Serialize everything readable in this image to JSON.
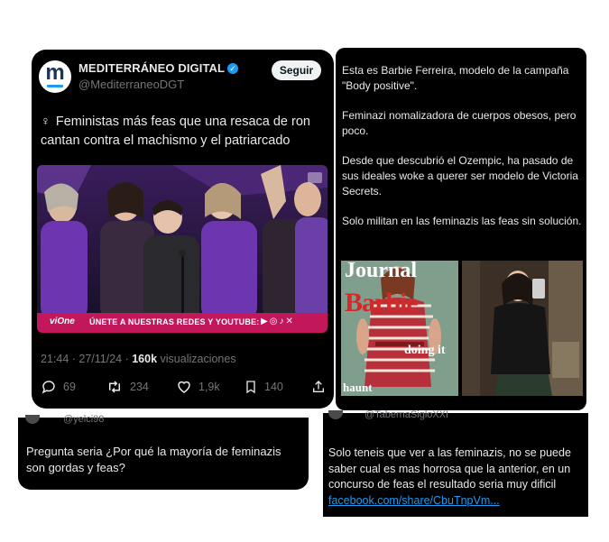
{
  "tweet": {
    "author_name": "MEDITERRÁNEO DIGITAL",
    "author_handle": "@MediterraneoDGT",
    "avatar_letter": "m",
    "follow_label": "Seguir",
    "text": "Feministas más feas que una resaca de ron cantan contra el machismo y el patriarcado",
    "media_banner_logo": "viOne",
    "media_banner_text": "ÚNETE A NUESTRAS REDES Y YOUTUBE:",
    "timestamp": "21:44 · 27/11/24 · ",
    "views_count": "160k",
    "views_label": " visualizaciones",
    "replies": "69",
    "reposts": "234",
    "likes": "1,9k",
    "bookmarks": "140"
  },
  "side_post": {
    "paragraphs": [
      "Esta es Barbie Ferreira, modelo de la campaña \"Body positive\".",
      "Feminazi nomalizadora de cuerpos obesos, pero poco.",
      "Desde que descubrió el Ozempic, ha pasado de sus ideales woke a querer ser modelo de Victoria Secrets.",
      "Solo militan en las feminazis las feas sin solución."
    ],
    "cover_top": "Journal",
    "cover_title": "Barbie",
    "cover_doit": "doing it",
    "cover_haunt": "haunt"
  },
  "reply1": {
    "handle": "@yelci98",
    "text": "Pregunta seria ¿Por qué la mayoría de feminazis son gordas y feas?"
  },
  "reply2": {
    "handle": "@TabernaSigloXXI",
    "text": "Solo teneis que ver a las feminazis, no se puede saber cual es mas horrosa que la anterior, en un concurso de feas el resultado seria muy dificil ",
    "link": "facebook.com/share/CbuTnpVm..."
  },
  "colors": {
    "background": "#000000",
    "text": "#e7e9ea",
    "muted": "#71767b",
    "link": "#1d9bf0",
    "banner": "#c2185b"
  },
  "icons": [
    "verified-badge-icon",
    "female-symbol-icon",
    "reply-icon",
    "repost-icon",
    "like-icon",
    "bookmark-icon",
    "share-icon",
    "youtube-icon",
    "instagram-icon",
    "tiktok-icon",
    "x-icon"
  ]
}
